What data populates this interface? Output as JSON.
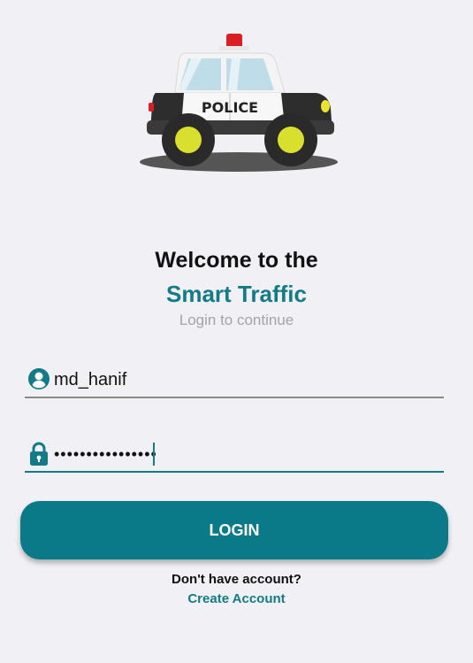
{
  "hero": {
    "image": "police-car-icon",
    "badge_text": "POLICE"
  },
  "header": {
    "welcome": "Welcome to the",
    "app_name": "Smart Traffic",
    "subtitle": "Login to continue"
  },
  "form": {
    "username": {
      "icon": "user-icon",
      "value": "md_hanif"
    },
    "password": {
      "icon": "lock-icon",
      "value": "••••••••••••••••"
    }
  },
  "actions": {
    "login_label": "LOGIN",
    "no_account_text": "Don't have account?",
    "create_account_label": "Create Account"
  },
  "colors": {
    "accent": "#127b87",
    "button": "#0a7a88",
    "background": "#f1f0f5"
  }
}
